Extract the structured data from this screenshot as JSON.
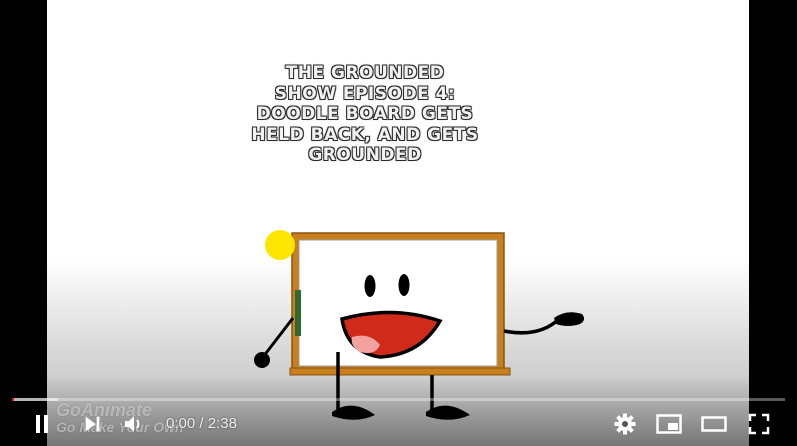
{
  "video": {
    "title_card": "THE GROUNDED\nSHOW EPISODE 4:\nDOODLE BOARD GETS\nHELD BACK, AND GETS\nGROUNDED",
    "watermark_logo": "GoAnimate",
    "watermark_tagline": "Go Make Your Own"
  },
  "controls": {
    "current_time": "0:00",
    "separator": " / ",
    "duration": "2:38",
    "play_state": "playing",
    "progress_fraction": 0.0,
    "buffered_fraction": 0.06,
    "icons": [
      "pause-icon",
      "next-icon",
      "volume-icon",
      "gear-icon",
      "miniplayer-icon",
      "theater-icon",
      "fullscreen-icon"
    ]
  },
  "colors": {
    "progress_played": "#ff0000",
    "board_frame": "#c8801e",
    "mouth": "#d02a1a",
    "tongue": "#f2a3a0",
    "sun": "#ffe600"
  }
}
